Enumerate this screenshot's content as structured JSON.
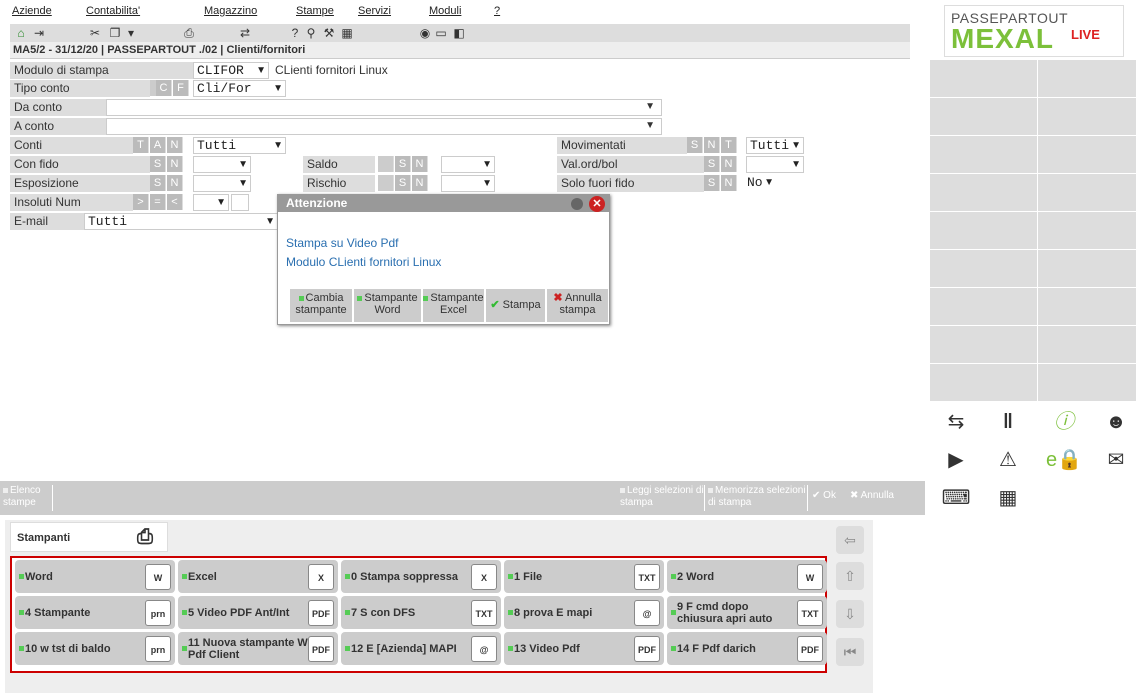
{
  "menu": [
    "Aziende",
    "Contabilita'",
    "Magazzino",
    "Stampe",
    "Servizi",
    "Moduli",
    "?"
  ],
  "breadcrumb": {
    "company": "MA5/2 - 31/12/20",
    "user": "PASSEPARTOUT ./02",
    "section": "Clienti/fornitori"
  },
  "logo": {
    "top": "PASSEPARTOUT",
    "main": "MEXAL",
    "tag": "LIVE"
  },
  "form": {
    "modulo_label": "Modulo di stampa",
    "modulo_value": "CLIFOR",
    "modulo_desc": "CLienti fornitori Linux",
    "tipo_label": "Tipo conto",
    "tipo_opts": [
      "C",
      "F"
    ],
    "tipo_value": "Cli/For",
    "da_label": "Da conto",
    "a_label": "A conto",
    "conti_label": "Conti",
    "conti_opts": [
      "T",
      "A",
      "N"
    ],
    "conti_value": "Tutti",
    "confido_label": "Con fido",
    "sn": [
      "S",
      "N"
    ],
    "espos_label": "Esposizione",
    "insoluti_label": "Insoluti Num",
    "ins_opts": [
      ">",
      "=",
      "<"
    ],
    "email_label": "E-mail",
    "email_value": "Tutti",
    "saldo_label": "Saldo",
    "rischio_label": "Rischio",
    "movim_label": "Movimentati",
    "movim_opts": [
      "S",
      "N",
      "T"
    ],
    "movim_value": "Tutti",
    "valord_label": "Val.ord/bol",
    "solo_label": "Solo fuori fido",
    "solo_value": "No"
  },
  "dialog": {
    "title": "Attenzione",
    "line1": "Stampa su Video Pdf",
    "line2": "Modulo CLienti fornitori Linux",
    "buttons": [
      "Cambia stampante",
      "Stampante Word",
      "Stampante Excel",
      "Stampa",
      "Annulla stampa"
    ]
  },
  "actions": {
    "elenco": "Elenco stampe",
    "leggi": "Leggi selezioni di stampa",
    "memorizza": "Memorizza selezioni di stampa",
    "ok": "Ok",
    "annulla": "Annulla"
  },
  "printers": {
    "tab": "Stampanti",
    "items": [
      {
        "label": "Word",
        "icon": "W"
      },
      {
        "label": "Excel",
        "icon": "X"
      },
      {
        "label": "0 Stampa soppressa",
        "icon": "X"
      },
      {
        "label": "1 File",
        "icon": "TXT"
      },
      {
        "label": "2 Word",
        "icon": "W"
      },
      {
        "label": "4 Stampante",
        "icon": "prn"
      },
      {
        "label": "5 Video PDF Ant/Int",
        "icon": "PDF"
      },
      {
        "label": "7 S con DFS",
        "icon": "TXT"
      },
      {
        "label": "8 prova E mapi",
        "icon": "@"
      },
      {
        "label": "9 F cmd dopo chiusura apri auto",
        "icon": "TXT"
      },
      {
        "label": "10 w tst di baldo",
        "icon": "prn"
      },
      {
        "label": "11 Nuova stampante W Pdf Client",
        "icon": "PDF"
      },
      {
        "label": "12 E [Azienda] MAPI",
        "icon": "@"
      },
      {
        "label": "13 Video Pdf",
        "icon": "PDF"
      },
      {
        "label": "14 F Pdf darich",
        "icon": "PDF"
      }
    ]
  }
}
